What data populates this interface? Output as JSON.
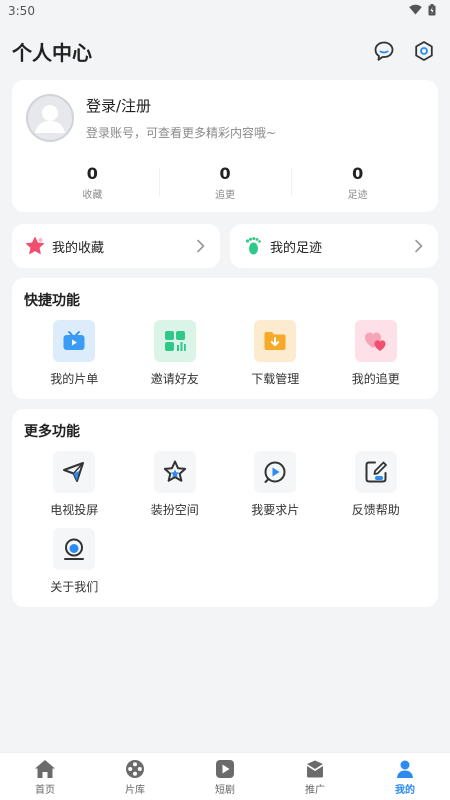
{
  "status_bar": {
    "time": "3:50"
  },
  "header": {
    "title": "个人中心"
  },
  "profile": {
    "login_title": "登录/注册",
    "login_subtitle": "登录账号，可查看更多精彩内容哦~"
  },
  "stats": [
    {
      "value": "0",
      "label": "收藏"
    },
    {
      "value": "0",
      "label": "追更"
    },
    {
      "value": "0",
      "label": "足迹"
    }
  ],
  "quick_links": [
    {
      "label": "我的收藏",
      "icon": "star-icon"
    },
    {
      "label": "我的足迹",
      "icon": "footprint-icon"
    }
  ],
  "shortcuts": {
    "title": "快捷功能",
    "items": [
      {
        "label": "我的片单",
        "icon": "tv-list-icon",
        "bg": "#dcecfb"
      },
      {
        "label": "邀请好友",
        "icon": "invite-icon",
        "bg": "#daf5e8"
      },
      {
        "label": "下载管理",
        "icon": "download-folder-icon",
        "bg": "#fdebd0"
      },
      {
        "label": "我的追更",
        "icon": "hearts-icon",
        "bg": "#fde0e8"
      }
    ]
  },
  "more": {
    "title": "更多功能",
    "items": [
      {
        "label": "电视投屏",
        "icon": "cast-icon"
      },
      {
        "label": "装扮空间",
        "icon": "star-outline-icon"
      },
      {
        "label": "我要求片",
        "icon": "request-play-icon"
      },
      {
        "label": "反馈帮助",
        "icon": "feedback-edit-icon"
      },
      {
        "label": "关于我们",
        "icon": "about-icon"
      }
    ]
  },
  "bottom_nav": [
    {
      "label": "首页",
      "icon": "home-icon"
    },
    {
      "label": "片库",
      "icon": "film-reel-icon"
    },
    {
      "label": "短剧",
      "icon": "play-square-icon"
    },
    {
      "label": "推广",
      "icon": "mail-icon"
    },
    {
      "label": "我的",
      "icon": "user-icon",
      "active": true
    }
  ],
  "colors": {
    "accent": "#2b8bf0",
    "background": "#f3f4f6"
  }
}
